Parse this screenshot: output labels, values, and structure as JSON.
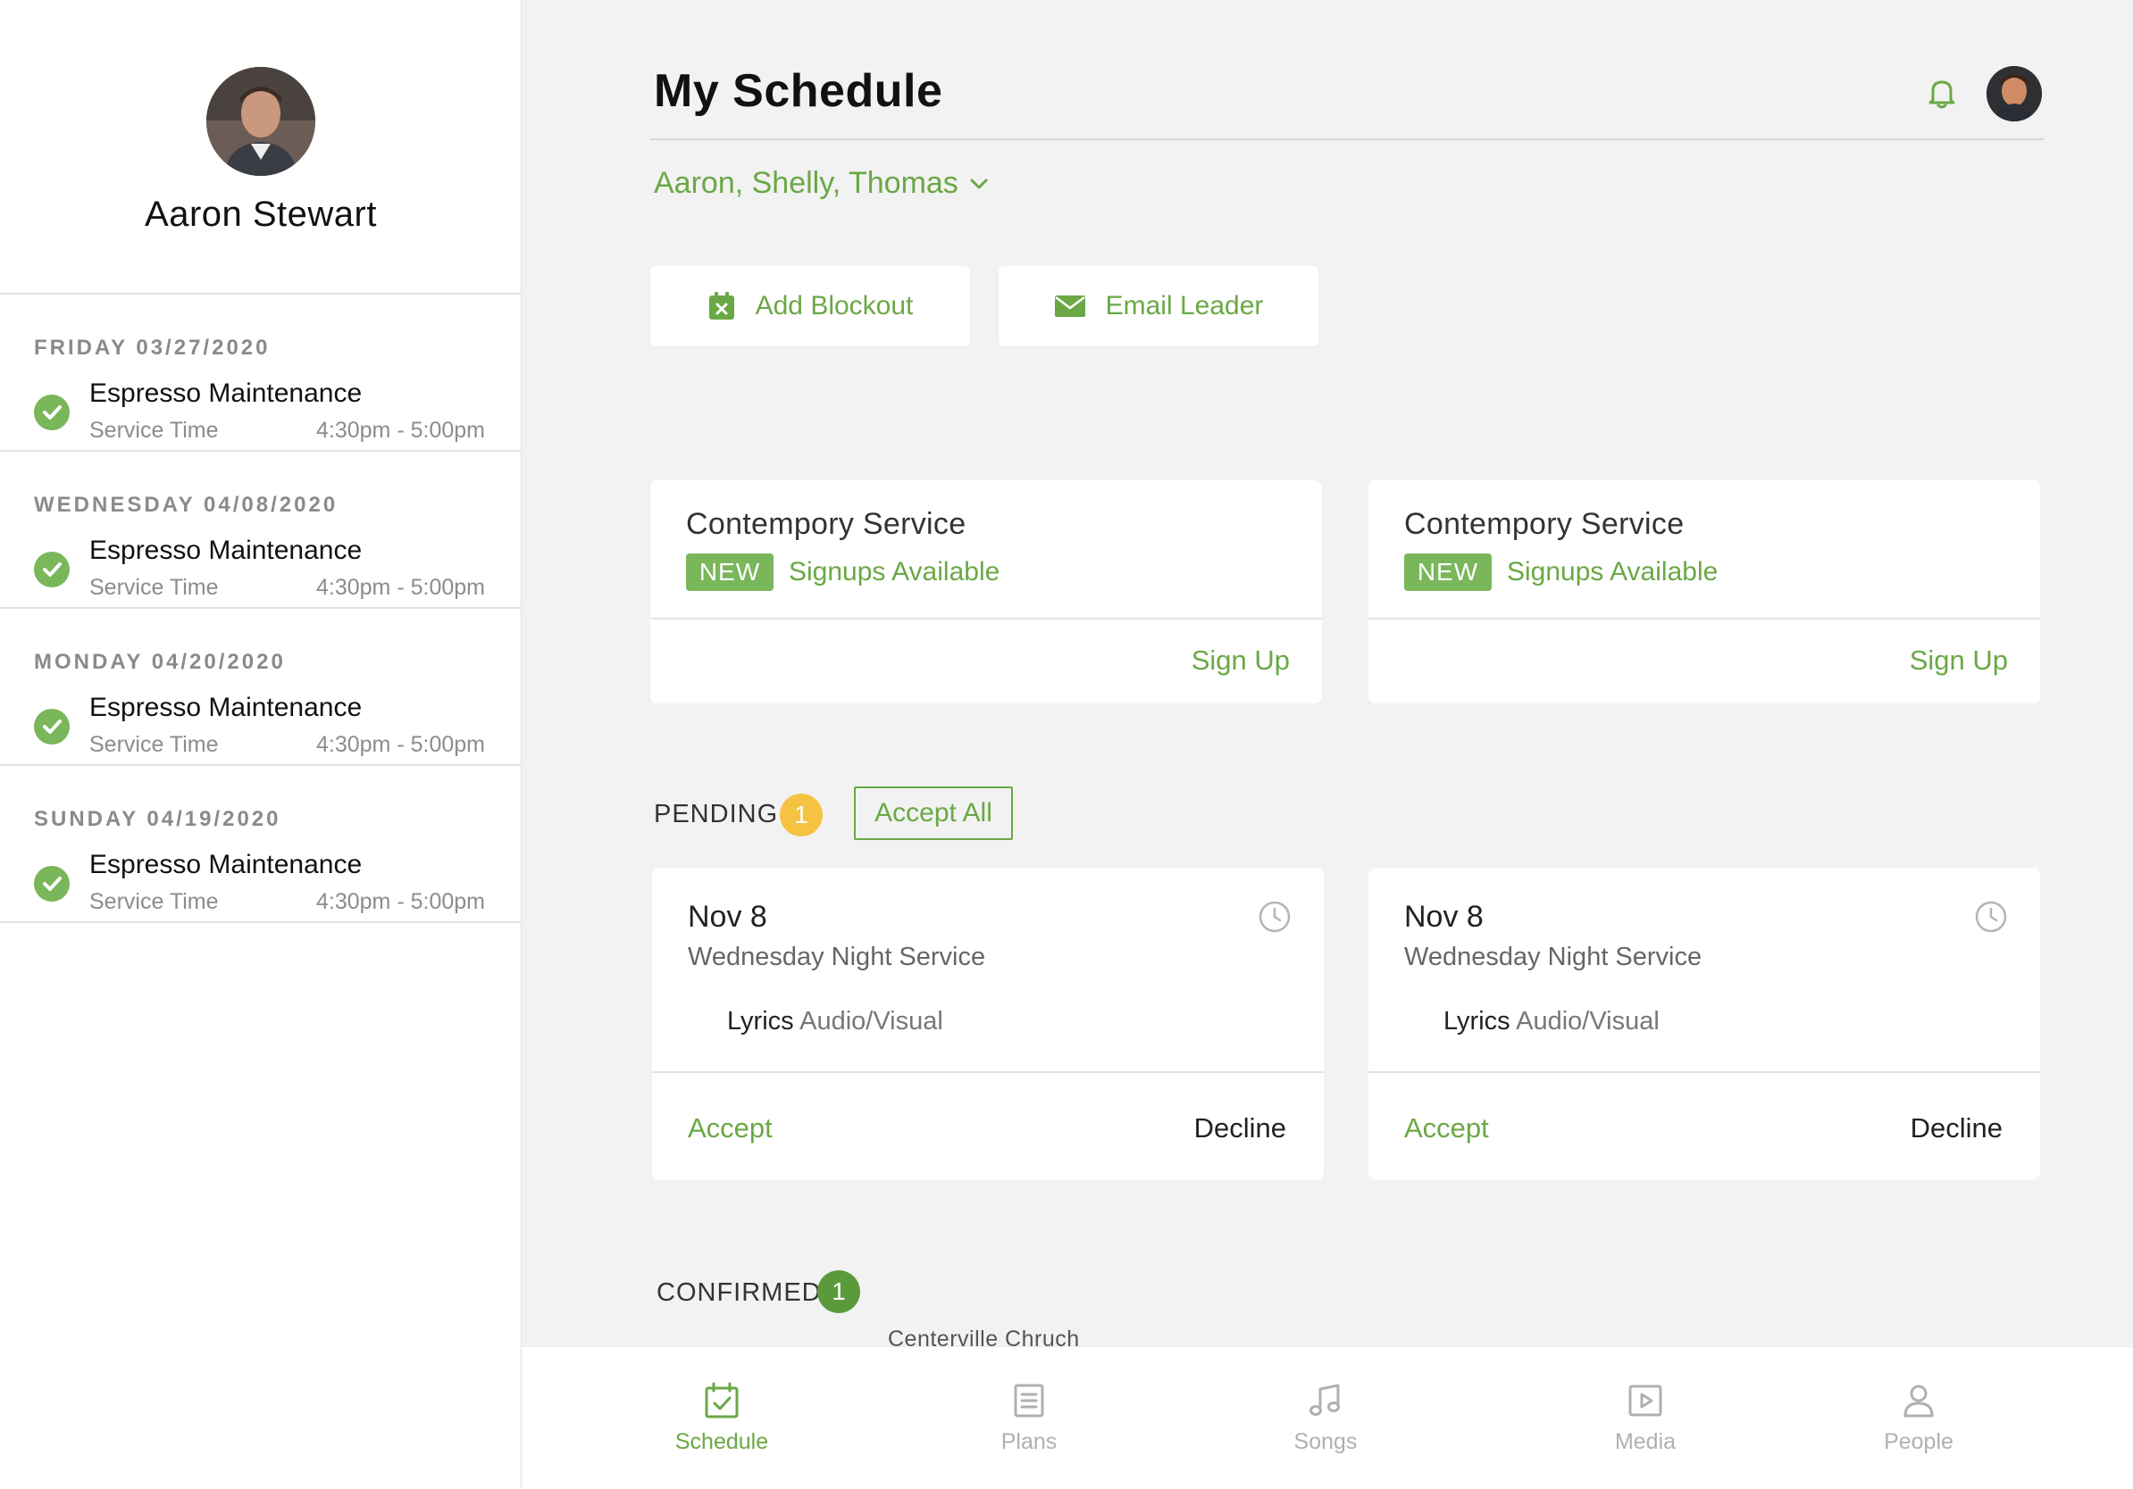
{
  "sidebar": {
    "user_name": "Aaron Stewart",
    "items": [
      {
        "date": "FRIDAY 03/27/2020",
        "title": "Espresso Maintenance",
        "subtitle": "Service Time",
        "time": "4:30pm - 5:00pm"
      },
      {
        "date": "WEDNESDAY 04/08/2020",
        "title": "Espresso Maintenance",
        "subtitle": "Service Time",
        "time": "4:30pm - 5:00pm"
      },
      {
        "date": "MONDAY 04/20/2020",
        "title": "Espresso Maintenance",
        "subtitle": "Service Time",
        "time": "4:30pm - 5:00pm"
      },
      {
        "date": "SUNDAY 04/19/2020",
        "title": "Espresso Maintenance",
        "subtitle": "Service Time",
        "time": "4:30pm - 5:00pm"
      }
    ]
  },
  "header": {
    "title": "My Schedule",
    "people_filter": "Aaron, Shelly, Thomas"
  },
  "actions": {
    "add_blockout": "Add Blockout",
    "email_leader": "Email Leader"
  },
  "signups": [
    {
      "title": "Contempory Service",
      "badge": "NEW",
      "status": "Signups Available",
      "action": "Sign Up"
    },
    {
      "title": "Contempory Service",
      "badge": "NEW",
      "status": "Signups Available",
      "action": "Sign Up"
    }
  ],
  "pending": {
    "label": "PENDING",
    "count": "1",
    "accept_all": "Accept All",
    "cards": [
      {
        "date": "Nov 8",
        "service": "Wednesday Night Service",
        "role": "Lyrics",
        "team": "Audio/Visual",
        "accept": "Accept",
        "decline": "Decline"
      },
      {
        "date": "Nov 8",
        "service": "Wednesday Night Service",
        "role": "Lyrics",
        "team": "Audio/Visual",
        "accept": "Accept",
        "decline": "Decline"
      }
    ]
  },
  "confirmed": {
    "label": "CONFIRMED",
    "count": "1",
    "church": "Centerville Chruch"
  },
  "tabbar": [
    {
      "label": "Schedule",
      "icon": "calendar-check-icon",
      "active": true
    },
    {
      "label": "Plans",
      "icon": "document-list-icon",
      "active": false
    },
    {
      "label": "Songs",
      "icon": "music-note-icon",
      "active": false
    },
    {
      "label": "Media",
      "icon": "play-square-icon",
      "active": false
    },
    {
      "label": "People",
      "icon": "person-icon",
      "active": false
    }
  ],
  "colors": {
    "accent": "#6aa845",
    "check": "#7ab65a",
    "pending_badge": "#f5c242",
    "confirmed_badge": "#5b9a3c"
  }
}
